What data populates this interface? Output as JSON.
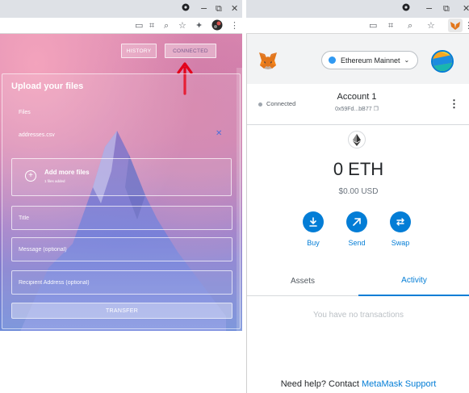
{
  "left_window": {
    "titlebar": {
      "minimize": "−",
      "restore": "⧉",
      "close": "✕"
    },
    "toolbar_icons": [
      "cast-icon",
      "qr-icon",
      "zoom-icon",
      "star-icon",
      "extensions-icon",
      "profile-icon",
      "menu-icon"
    ],
    "nav": {
      "history": "HISTORY",
      "connected": "CONNECTED"
    },
    "panel": {
      "title": "Upload your files",
      "files_label": "Files",
      "file_name": "addresses.csv",
      "remove_symbol": "✕",
      "add_more_title": "Add more files",
      "add_more_subtitle": "1 files added",
      "title_placeholder": "Title",
      "message_placeholder": "Message (optional)",
      "recipient_placeholder": "Recipient Address (optional)",
      "transfer_label": "TRANSFER"
    },
    "colors": {
      "annotation_arrow": "#e3001b",
      "remove_icon": "#4b6fdc"
    }
  },
  "right_window": {
    "titlebar": {
      "minimize": "−",
      "restore": "⧉",
      "close": "✕"
    },
    "metamask": {
      "network": "Ethereum Mainnet",
      "connection_status": "Connected",
      "account_name": "Account 1",
      "account_address": "0x59Fd...bB77",
      "balance": "0 ETH",
      "balance_usd": "$0.00 USD",
      "actions": {
        "buy": "Buy",
        "send": "Send",
        "swap": "Swap"
      },
      "tabs": {
        "assets": "Assets",
        "activity": "Activity"
      },
      "empty_activity": "You have no transactions",
      "help_prefix": "Need help? Contact ",
      "help_link": "MetaMask Support"
    },
    "colors": {
      "primary": "#037dd6",
      "network_dot": "#3099f2",
      "fox": "#e2761b"
    }
  }
}
